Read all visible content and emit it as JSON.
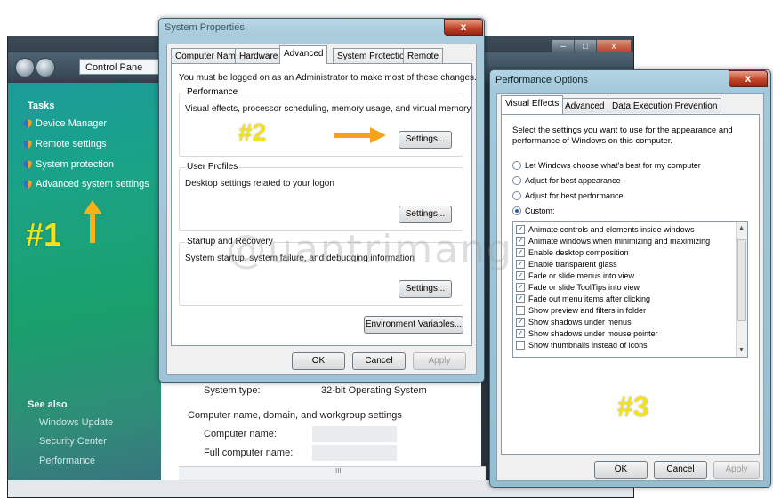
{
  "control_panel": {
    "address": "Control Pane",
    "tasks_title": "Tasks",
    "tasks": [
      "Device Manager",
      "Remote settings",
      "System protection",
      "Advanced system settings"
    ],
    "see_also_title": "See also",
    "see_also": [
      "Windows Update",
      "Security Center",
      "Performance"
    ],
    "system_type_label": "System type:",
    "system_type_value": "32-bit Operating System",
    "section_heading": "Computer name, domain, and workgroup settings",
    "computer_name_label": "Computer name:",
    "full_computer_name_label": "Full computer name:",
    "scroll_marker": "III"
  },
  "annotations": {
    "a1": "#1",
    "a2": "#2",
    "a3": "#3"
  },
  "system_properties": {
    "title": "System Properties",
    "close": "x",
    "tabs": [
      "Computer Name",
      "Hardware",
      "Advanced",
      "System Protection",
      "Remote"
    ],
    "active_tab": "Advanced",
    "admin_note": "You must be logged on as an Administrator to make most of these changes.",
    "performance": {
      "label": "Performance",
      "desc": "Visual effects, processor scheduling, memory usage, and virtual memory",
      "button": "Settings..."
    },
    "user_profiles": {
      "label": "User Profiles",
      "desc": "Desktop settings related to your logon",
      "button": "Settings..."
    },
    "startup_recovery": {
      "label": "Startup and Recovery",
      "desc": "System startup, system failure, and debugging information",
      "button": "Settings..."
    },
    "env_button": "Environment Variables...",
    "ok": "OK",
    "cancel": "Cancel",
    "apply": "Apply"
  },
  "performance_options": {
    "title": "Performance Options",
    "close": "x",
    "tabs": [
      "Visual Effects",
      "Advanced",
      "Data Execution Prevention"
    ],
    "intro": "Select the settings you want to use for the appearance and performance of Windows on this computer.",
    "radios": [
      {
        "label": "Let Windows choose what's best for my computer",
        "checked": false
      },
      {
        "label": "Adjust for best appearance",
        "checked": false
      },
      {
        "label": "Adjust for best performance",
        "checked": false
      },
      {
        "label": "Custom:",
        "checked": true
      }
    ],
    "effects": [
      {
        "label": "Animate controls and elements inside windows",
        "checked": true
      },
      {
        "label": "Animate windows when minimizing and maximizing",
        "checked": true
      },
      {
        "label": "Enable desktop composition",
        "checked": true
      },
      {
        "label": "Enable transparent glass",
        "checked": true
      },
      {
        "label": "Fade or slide menus into view",
        "checked": true
      },
      {
        "label": "Fade or slide ToolTips into view",
        "checked": true
      },
      {
        "label": "Fade out menu items after clicking",
        "checked": true
      },
      {
        "label": "Show preview and filters in folder",
        "checked": false
      },
      {
        "label": "Show shadows under menus",
        "checked": true
      },
      {
        "label": "Show shadows under mouse pointer",
        "checked": true
      },
      {
        "label": "Show thumbnails instead of icons",
        "checked": false
      }
    ],
    "ok": "OK",
    "cancel": "Cancel",
    "apply": "Apply"
  },
  "watermark": "@uantrimang",
  "colors": {
    "annotation": "#f2e21b",
    "arrow": "#f5a21b"
  }
}
